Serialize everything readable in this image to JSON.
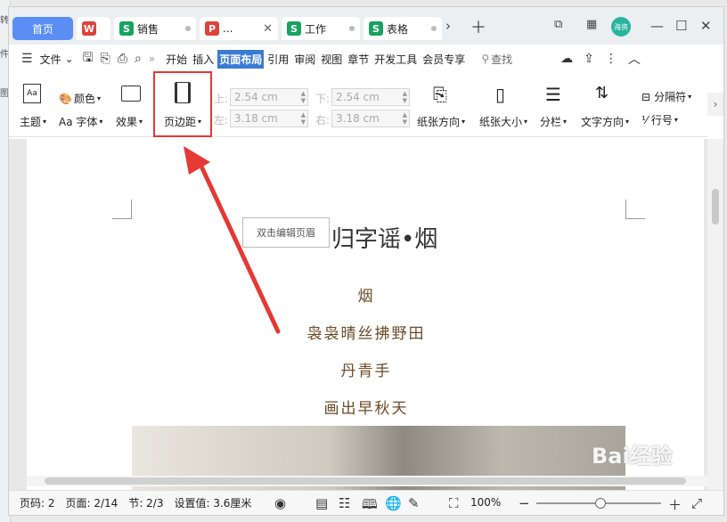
{
  "tabs": [
    {
      "label": "首页"
    },
    {
      "label": ""
    },
    {
      "label": "销售"
    },
    {
      "label": "..."
    },
    {
      "label": "工作"
    },
    {
      "label": "表格"
    }
  ],
  "tab_badge": "海资",
  "menu": {
    "file": "文件",
    "items": [
      "开始",
      "插入",
      "页面布局",
      "引用",
      "审阅",
      "视图",
      "章节",
      "开发工具",
      "会员专享"
    ],
    "search": "查找"
  },
  "ribbon": {
    "theme": "主题",
    "color": "颜色",
    "font": "Aa 字体",
    "effect": "效果",
    "margin": "页边距",
    "top_label": "上:",
    "top_val": "2.54 cm",
    "left_label": "左:",
    "left_val": "3.18 cm",
    "bottom_label": "下:",
    "bottom_val": "2.54 cm",
    "right_label": "右:",
    "right_val": "3.18 cm",
    "orientation": "纸张方向",
    "size": "纸张大小",
    "columns": "分栏",
    "text_dir": "文字方向",
    "break": "分隔符",
    "line_no": "行号"
  },
  "doc": {
    "header_tip": "双击编辑页眉",
    "title": "归字谣•烟",
    "lines": [
      "烟",
      "袅袅晴丝拂野田",
      "丹青手",
      "画出早秋天"
    ]
  },
  "status": {
    "page_num": "页码: 2",
    "pages": "页面: 2/14",
    "section": "节: 2/3",
    "setting": "设置值: 3.6厘米",
    "zoom": "100%"
  },
  "watermark": "Bai经验"
}
